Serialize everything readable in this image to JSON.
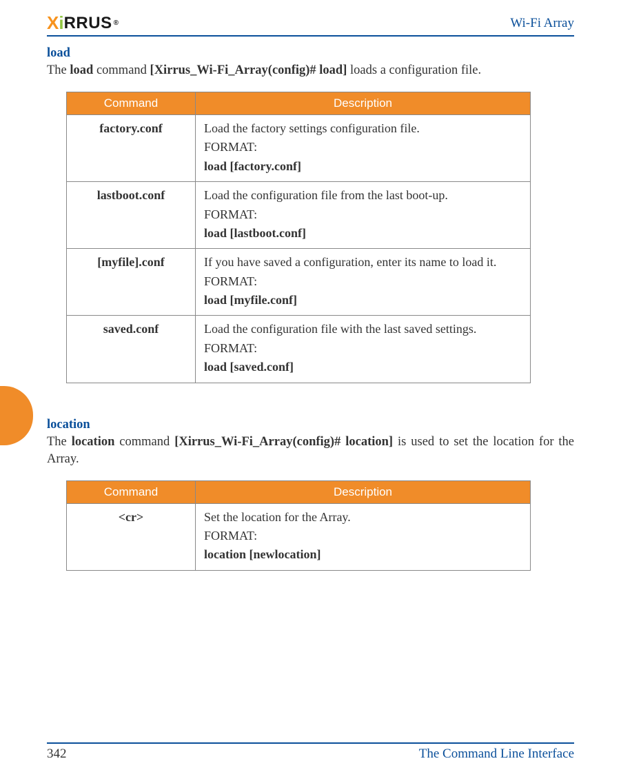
{
  "header": {
    "product": "Wi-Fi Array"
  },
  "logo": {
    "x": "X",
    "i": "i",
    "rest": "RRUS",
    "reg": "®"
  },
  "s1": {
    "title": "load",
    "intro": {
      "pre": "The ",
      "b1": "load",
      "mid": " command ",
      "b2": "[Xirrus_Wi-Fi_Array(config)# load]",
      "post": " loads a configuration file."
    },
    "th": {
      "cmd": "Command",
      "desc": "Description"
    },
    "rows": [
      {
        "cmd": "factory.conf",
        "d1": "Load the factory settings configuration file.",
        "fmt": "FORMAT:",
        "b": "load [factory.conf]"
      },
      {
        "cmd": "lastboot.conf",
        "d1": "Load the configuration file from the last boot-up.",
        "fmt": "FORMAT:",
        "b": "load [lastboot.conf]"
      },
      {
        "cmd": "[myfile].conf",
        "d1": "If you have saved a configuration, enter its name to load it.",
        "fmt": "FORMAT:",
        "b": "load [myfile.conf]"
      },
      {
        "cmd": "saved.conf",
        "d1": "Load the configuration file with the last saved settings.",
        "fmt": "FORMAT:",
        "b": "load [saved.conf]"
      }
    ]
  },
  "s2": {
    "title": "location",
    "intro": {
      "pre": "The ",
      "b1": "location",
      "mid": " command ",
      "b2": "[Xirrus_Wi-Fi_Array(config)# location]",
      "post": " is used to set the location for the Array."
    },
    "th": {
      "cmd": "Command",
      "desc": "Description"
    },
    "rows": [
      {
        "cmd": "<cr>",
        "d1": "Set the location for the Array.",
        "fmt": "FORMAT:",
        "b": "location [newlocation]"
      }
    ]
  },
  "footer": {
    "page": "342",
    "chapter": "The Command Line Interface"
  }
}
